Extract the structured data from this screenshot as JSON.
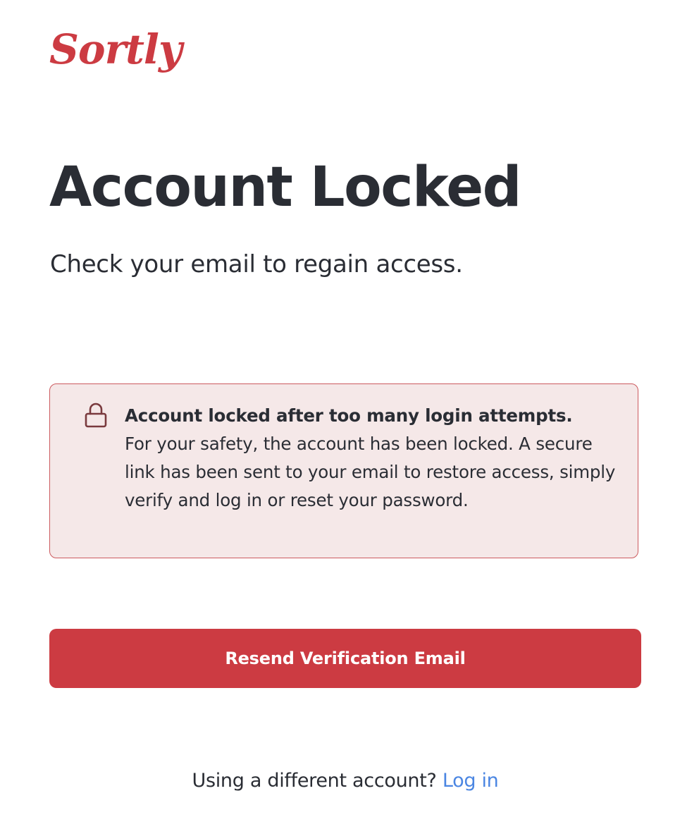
{
  "brand": {
    "logo_text": "Sortly",
    "color": "#cc3b42"
  },
  "page": {
    "title": "Account Locked",
    "subtitle": "Check your email to regain access."
  },
  "alert": {
    "icon": "lock-icon",
    "heading": "Account locked after too many login attempts.",
    "body": "For your safety, the account has been locked. A secure link has been sent to your email to restore access, simply verify and log in or reset your password.",
    "background_color": "#f5e8e8",
    "border_color": "#cc5a5e"
  },
  "actions": {
    "resend_label": "Resend Verification Email",
    "button_color": "#cc3b42"
  },
  "footer": {
    "prompt": "Using a different account?",
    "login_label": "Log in",
    "link_color": "#4b86e2"
  }
}
